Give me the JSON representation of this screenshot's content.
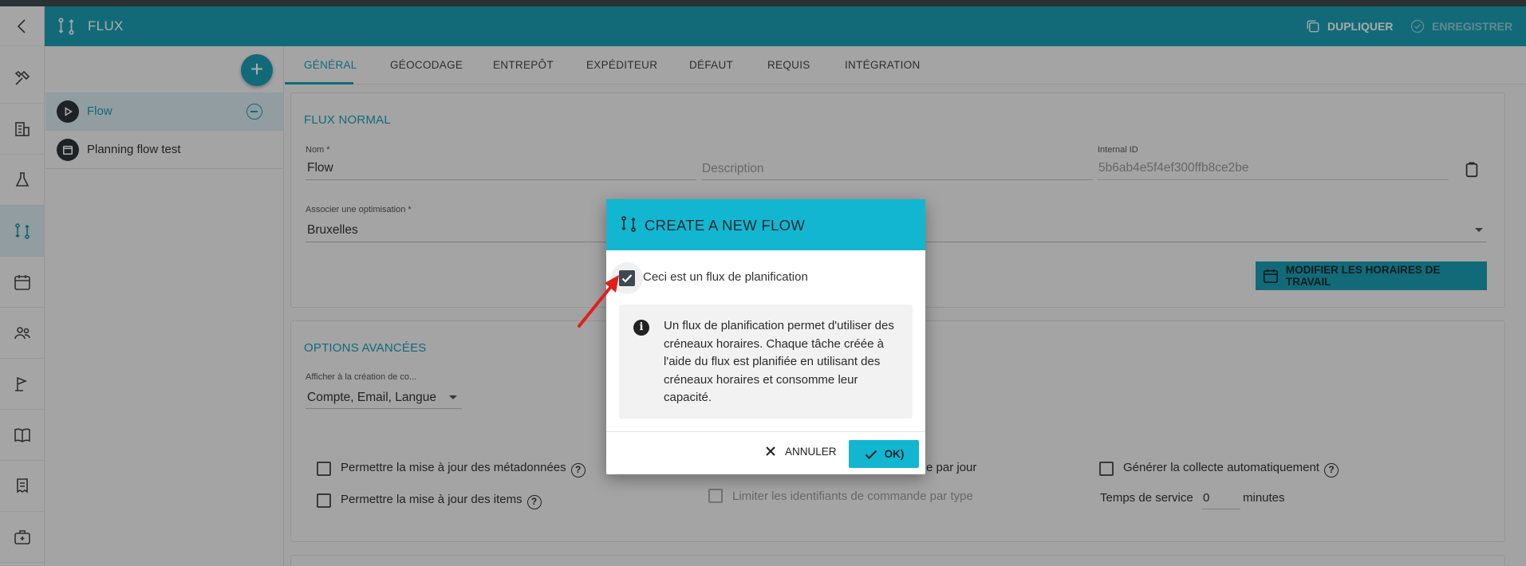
{
  "header": {
    "title": "FLUX",
    "duplicate_label": "DUPLIQUER",
    "save_label": "ENREGISTRER"
  },
  "flow_list": [
    {
      "label": "Flow"
    },
    {
      "label": "Planning flow test"
    }
  ],
  "tabs": [
    {
      "label": "GÉNÉRAL"
    },
    {
      "label": "GÉOCODAGE"
    },
    {
      "label": "ENTREPÔT"
    },
    {
      "label": "EXPÉDITEUR"
    },
    {
      "label": "DÉFAUT"
    },
    {
      "label": "REQUIS"
    },
    {
      "label": "INTÉGRATION"
    }
  ],
  "normal_flow": {
    "section_title": "FLUX NORMAL",
    "name_label": "Nom *",
    "name_value": "Flow",
    "description_placeholder": "Description",
    "internal_id_label": "Internal ID",
    "internal_id_value": "5b6ab4e5f4ef300ffb8ce2be",
    "optimisation_label": "Associer une optimisation *",
    "optimisation_value": "Bruxelles",
    "work_hours_button": "MODIFIER LES HORAIRES DE TRAVAIL"
  },
  "advanced": {
    "section_title": "OPTIONS AVANCÉES",
    "display_label": "Afficher à la création de co...",
    "display_value": "Compte, Email, Langue",
    "cb_metadata": "Permettre la mise à jour des métadonnées",
    "cb_items": "Permettre la mise à jour des items",
    "cb_per_day": "e par jour",
    "cb_limit_ids": "Limiter les identifiants de commande par type",
    "cb_auto_collect": "Générer la collecte automatiquement",
    "service_time_label": "Temps de service",
    "service_time_value": "0",
    "service_time_unit": "minutes"
  },
  "dialog": {
    "title": "CREATE A NEW FLOW",
    "checkbox_label": "Ceci est un flux de planification",
    "checkbox_checked": true,
    "info_text": "Un flux de planification permet d'utiliser des créneaux horaires. Chaque tâche créée à l'aide du flux est planifiée en utilisant des créneaux horaires et consomme leur capacité.",
    "cancel_label": "ANNULER",
    "ok_label": "OK)"
  },
  "colors": {
    "accent": "#1b9db2",
    "dialog_header": "#13b6d1",
    "annotation_arrow": "#e0201b"
  }
}
